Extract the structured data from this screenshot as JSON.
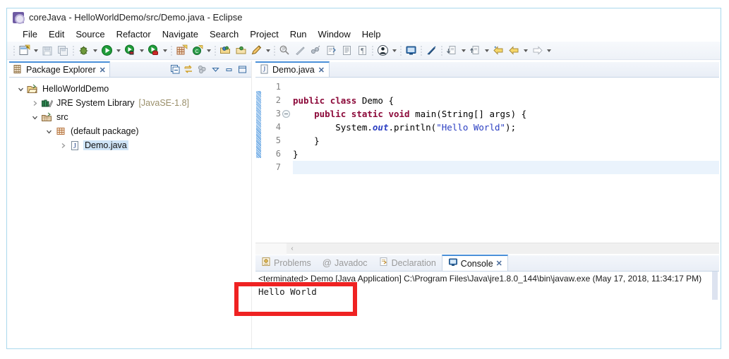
{
  "window": {
    "title": "coreJava - HelloWorldDemo/src/Demo.java - Eclipse",
    "app_icon": "eclipse-icon"
  },
  "menubar": {
    "items": [
      {
        "label": "File"
      },
      {
        "label": "Edit"
      },
      {
        "label": "Source"
      },
      {
        "label": "Refactor"
      },
      {
        "label": "Navigate"
      },
      {
        "label": "Search"
      },
      {
        "label": "Project"
      },
      {
        "label": "Run"
      },
      {
        "label": "Window"
      },
      {
        "label": "Help"
      }
    ]
  },
  "toolbar": {
    "buttons": [
      {
        "name": "new-wizard-icon",
        "kind": "new"
      },
      {
        "name": "new-wizard-dropdown",
        "kind": "arrow"
      },
      {
        "name": "save-icon",
        "kind": "save"
      },
      {
        "name": "save-all-icon",
        "kind": "saveall"
      },
      {
        "name": "separator",
        "kind": "sep"
      },
      {
        "name": "debug-icon",
        "kind": "debug"
      },
      {
        "name": "debug-dropdown",
        "kind": "arrow"
      },
      {
        "name": "run-icon",
        "kind": "run"
      },
      {
        "name": "run-dropdown",
        "kind": "arrow"
      },
      {
        "name": "run-external-tools-icon",
        "kind": "greenball-black"
      },
      {
        "name": "external-tools-dropdown",
        "kind": "arrow"
      },
      {
        "name": "coverage-icon",
        "kind": "greenball-red"
      },
      {
        "name": "coverage-dropdown",
        "kind": "arrow"
      },
      {
        "name": "separator",
        "kind": "sep"
      },
      {
        "name": "new-java-project-icon",
        "kind": "grid"
      },
      {
        "name": "new-class-icon",
        "kind": "circle-c"
      },
      {
        "name": "new-class-dropdown",
        "kind": "arrow"
      },
      {
        "name": "separator",
        "kind": "sep"
      },
      {
        "name": "open-type-icon",
        "kind": "folder-open"
      },
      {
        "name": "open-task-icon",
        "kind": "folder-plain"
      },
      {
        "name": "toggle-mark-occurrences-icon",
        "kind": "pencil"
      },
      {
        "name": "mark-occurrences-dropdown",
        "kind": "arrow"
      },
      {
        "name": "separator",
        "kind": "sep"
      },
      {
        "name": "search-icon",
        "kind": "search-p"
      },
      {
        "name": "skip-breakpoints-icon",
        "kind": "slash"
      },
      {
        "name": "link-icon",
        "kind": "dots"
      },
      {
        "name": "open-task-list-icon",
        "kind": "doc-arrow"
      },
      {
        "name": "show-whitespace-icon",
        "kind": "doc-lines"
      },
      {
        "name": "pilcrow-icon",
        "kind": "pilcrow"
      },
      {
        "name": "separator",
        "kind": "sep"
      },
      {
        "name": "user-icon",
        "kind": "person"
      },
      {
        "name": "user-dropdown",
        "kind": "arrow"
      },
      {
        "name": "separator",
        "kind": "sep"
      },
      {
        "name": "open-perspective-icon",
        "kind": "monitor"
      },
      {
        "name": "separator",
        "kind": "sep"
      },
      {
        "name": "skip-all-breakpoints-icon",
        "kind": "pen-slash"
      },
      {
        "name": "separator",
        "kind": "sep"
      },
      {
        "name": "previous-annotation-icon",
        "kind": "down-arrow-doc"
      },
      {
        "name": "previous-annotation-dropdown",
        "kind": "arrow"
      },
      {
        "name": "next-annotation-icon",
        "kind": "up-arrow-doc"
      },
      {
        "name": "next-annotation-dropdown",
        "kind": "arrow"
      },
      {
        "name": "last-edit-location-icon",
        "kind": "yellow-back-star"
      },
      {
        "name": "back-icon",
        "kind": "yellow-back"
      },
      {
        "name": "back-dropdown",
        "kind": "arrow"
      },
      {
        "name": "forward-icon",
        "kind": "forward"
      },
      {
        "name": "forward-dropdown",
        "kind": "arrow"
      }
    ]
  },
  "explorer": {
    "tab_label": "Package Explorer",
    "tab_close": "✕",
    "toolbar_icons": [
      {
        "name": "collapse-all-icon"
      },
      {
        "name": "link-with-editor-icon"
      },
      {
        "name": "view-menu-dots-icon"
      },
      {
        "name": "view-menu-icon"
      },
      {
        "name": "minimize-view-icon"
      },
      {
        "name": "maximize-view-icon"
      }
    ],
    "tree": [
      {
        "label": "HelloWorldDemo",
        "sub": "",
        "depth": 0,
        "twisty": "down",
        "icon": "project-icon",
        "selected": false
      },
      {
        "label": "JRE System Library",
        "sub": "[JavaSE-1.8]",
        "depth": 1,
        "twisty": "right",
        "icon": "library-icon",
        "selected": false
      },
      {
        "label": "src",
        "sub": "",
        "depth": 1,
        "twisty": "down",
        "icon": "source-folder-icon",
        "selected": false
      },
      {
        "label": "(default package)",
        "sub": "",
        "depth": 2,
        "twisty": "down",
        "icon": "package-icon",
        "selected": false
      },
      {
        "label": "Demo.java",
        "sub": "",
        "depth": 3,
        "twisty": "right",
        "icon": "java-file-icon",
        "selected": true
      }
    ]
  },
  "editor": {
    "tab_label": "Demo.java",
    "tab_close": "✕",
    "tab_icon": "java-file-icon",
    "line_numbers": [
      "1",
      "2",
      "3",
      "4",
      "5",
      "6",
      "7"
    ],
    "fold_on_line": 3,
    "lines": [
      {
        "n": "1",
        "text": "",
        "current": false
      },
      {
        "n": "2",
        "text": "public class Demo {",
        "current": false
      },
      {
        "n": "3",
        "text": "    public static void main(String[] args) {",
        "current": false
      },
      {
        "n": "4",
        "text": "        System.out.println(\"Hello World\");",
        "current": false
      },
      {
        "n": "5",
        "text": "    }",
        "current": false
      },
      {
        "n": "6",
        "text": "}",
        "current": false
      },
      {
        "n": "7",
        "text": "",
        "current": true
      }
    ],
    "hscroll_arrow": "‹"
  },
  "console": {
    "tabs": [
      {
        "label": "Problems",
        "icon": "problems-icon",
        "active": false
      },
      {
        "label": "Javadoc",
        "icon": "javadoc-icon",
        "active": false
      },
      {
        "label": "Declaration",
        "icon": "declaration-icon",
        "active": false
      },
      {
        "label": "Console",
        "icon": "console-icon",
        "active": true,
        "close": "✕"
      }
    ],
    "header_line": "<terminated> Demo [Java Application] C:\\Program Files\\Java\\jre1.8.0_144\\bin\\javaw.exe (May 17, 2018, 11:34:17 PM)",
    "output": "Hello World"
  },
  "annotation": {
    "name": "red-highlight-box",
    "color": "#ef2222"
  }
}
